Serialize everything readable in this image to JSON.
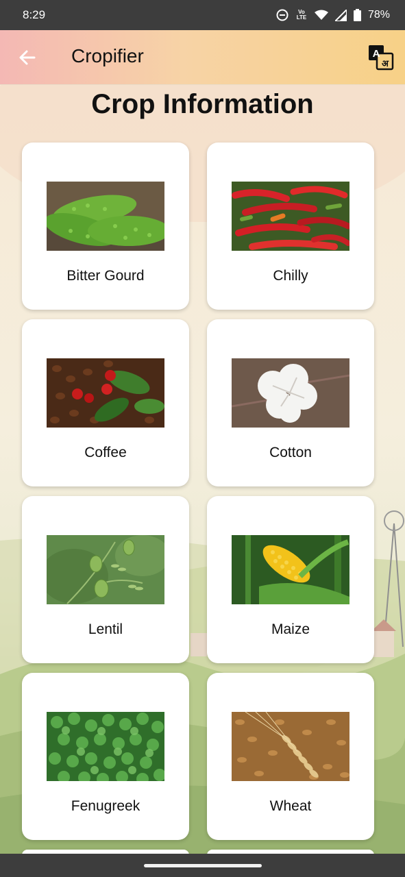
{
  "status_bar": {
    "time": "8:29",
    "network_label": "Vo LTE",
    "battery": "78%",
    "icons": [
      "do-not-disturb-icon",
      "volte-icon",
      "wifi-icon",
      "signal-icon",
      "battery-icon"
    ]
  },
  "app_bar": {
    "title": "Cropifier",
    "back_icon": "arrow-left-icon",
    "translate_icon": "translate-icon",
    "translate_glyphs": [
      "A",
      "अ"
    ]
  },
  "page": {
    "title": "Crop Information"
  },
  "crops": [
    {
      "name": "Bitter Gourd",
      "image": "bitter-gourd-image"
    },
    {
      "name": "Chilly",
      "image": "chilly-image"
    },
    {
      "name": "Coffee",
      "image": "coffee-image"
    },
    {
      "name": "Cotton",
      "image": "cotton-image"
    },
    {
      "name": "Lentil",
      "image": "lentil-image"
    },
    {
      "name": "Maize",
      "image": "maize-image"
    },
    {
      "name": "Fenugreek",
      "image": "fenugreek-image"
    },
    {
      "name": "Wheat",
      "image": "wheat-image"
    }
  ],
  "colors": {
    "status_bar": "#3d3d3d",
    "app_bar_start": "#f4b8b4",
    "app_bar_end": "#f7d187",
    "card": "#ffffff"
  }
}
